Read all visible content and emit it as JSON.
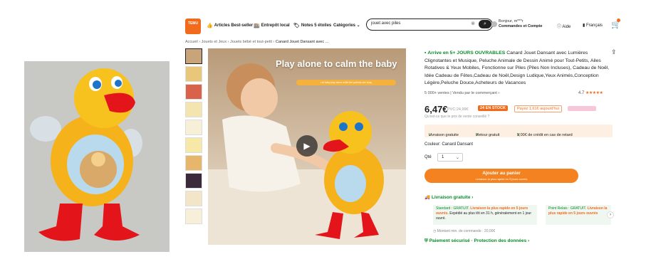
{
  "header": {
    "logo_text": "TEMU",
    "nav": [
      {
        "icon": "thumbs-up-icon",
        "label": "Articles Best-seller"
      },
      {
        "icon": "store-icon",
        "label": "Entrepôt local"
      },
      {
        "icon": "star-badge-icon",
        "label": "Notes 5 étoiles"
      },
      {
        "icon": "",
        "label": "Catégories ⌄"
      }
    ],
    "search": {
      "value": "jouet avec piles"
    },
    "account": {
      "line1": "Bonjour, m***r",
      "line2": "Commandes et Compte"
    },
    "help": "Aide",
    "language": "Français"
  },
  "breadcrumb": {
    "items": [
      "Accueil",
      "Jouets et Jeux",
      "Jouets bébé et tout-petit"
    ],
    "current": "Canard Jouet Dansant avec ..."
  },
  "media": {
    "banner": "Play alone to calm the baby",
    "sub_banner": "Let baby play alone while the parents are busy"
  },
  "product": {
    "delivery_prefix": "Arrive en 5+ JOURS OUVRABLES",
    "title": "Canard Jouet Dansant avec Lumières Clignotantes et Musique, Peluche Animale de Dessin Animé pour Tout-Petits, Ailes Rotatives & Yeux Mobiles, Fonctionne sur Piles (Piles Non Incluses), Cadeau de Noël, Idée Cadeau de Fêtes,Cadeau de Noël,Design Ludique,Yeux Animés,Conception Légère,Peluche Douce,Acheteurs de Vacances",
    "sold": "5 000+ ventes | Vendu par le commerçant",
    "rating": "4.7",
    "stars": "★★★★★",
    "price": "6,47€",
    "rrp": "PVC:24,99€",
    "stock_badge": "24 EN STOCK",
    "pay_in": "Payez 1,61€ aujourd'hui",
    "ref_note": "Qu'est-ce que le prix de vente conseillé ?",
    "perks": [
      "Livraison gratuite",
      "Retour gratuit",
      "5,00€ de crédit en cas de retard"
    ],
    "color_label": "Couleur: Canard Dansant",
    "qty_label": "Qté",
    "qty_value": "1",
    "add_to_cart": "Ajouter au panier",
    "add_to_cart_sub": "Livraison la plus rapide en 5 jours ouvrés"
  },
  "shipping": {
    "title": "Livraison gratuite ›",
    "standard": {
      "label": "Standard : GRATUIT.",
      "fast": "Livraison la plus rapide en 5 jours ouvrés.",
      "note": "Expédié au plus tôt en 31 h, généralement en 1 jour ouvré."
    },
    "relay": {
      "label": "Point Relais : GRATUIT.",
      "fast": "Livraison la plus rapide en 5 jours ouvrés"
    },
    "min_order": "Montant min. de commande : 20,00€",
    "secure": "Paiement sécurisé · Protection des données ›"
  },
  "colors": {
    "accent": "#f26b1d",
    "cart_button": "#f58220",
    "green": "#0a8a2a"
  }
}
